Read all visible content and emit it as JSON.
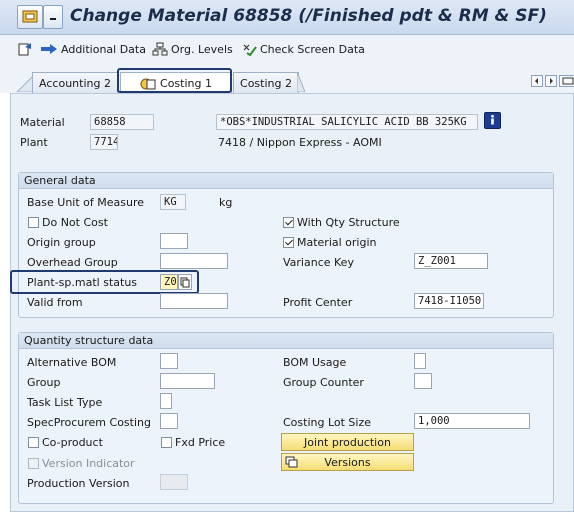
{
  "title_bar": {
    "title": "Change Material 68858 (/Finished pdt & RM & SF)"
  },
  "toolbar": {
    "additional_data": "Additional Data",
    "org_levels": "Org. Levels",
    "check_screen_data": "Check Screen Data"
  },
  "tabs": [
    {
      "label": "Accounting 2",
      "active": false
    },
    {
      "label": "Costing 1",
      "active": true
    },
    {
      "label": "Costing 2",
      "active": false
    }
  ],
  "header": {
    "material_label": "Material",
    "material_value": "68858",
    "material_desc": "*OBS*INDUSTRIAL SALICYLIC ACID BB 325KG",
    "plant_label": "Plant",
    "plant_value": "7714",
    "plant_desc": "7418 / Nippon Express - AOMI"
  },
  "general_data": {
    "title": "General data",
    "base_uom_label": "Base Unit of Measure",
    "base_uom_value": "KG",
    "base_uom_text": "kg",
    "do_not_cost_label": "Do Not Cost",
    "do_not_cost_checked": false,
    "with_qty_structure_label": "With Qty Structure",
    "with_qty_structure_checked": true,
    "origin_group_label": "Origin group",
    "origin_group_value": "",
    "material_origin_label": "Material origin",
    "material_origin_checked": true,
    "overhead_group_label": "Overhead Group",
    "overhead_group_value": "",
    "variance_key_label": "Variance Key",
    "variance_key_value": "Z_Z001",
    "plant_status_label": "Plant-sp.matl status",
    "plant_status_value": "Z0",
    "valid_from_label": "Valid from",
    "valid_from_value": "",
    "profit_center_label": "Profit Center",
    "profit_center_value": "7418-I1050"
  },
  "quantity_structure": {
    "title": "Quantity structure data",
    "alt_bom_label": "Alternative BOM",
    "bom_usage_label": "BOM Usage",
    "group_label": "Group",
    "group_counter_label": "Group Counter",
    "task_list_type_label": "Task List Type",
    "spec_procurem_label": "SpecProcurem Costing",
    "costing_lot_size_label": "Costing Lot Size",
    "costing_lot_size_value": "1,000",
    "co_product_label": "Co-product",
    "fxd_price_label": "Fxd Price",
    "joint_production_label": "Joint production",
    "version_indicator_label": "Version Indicator",
    "versions_label": "Versions",
    "production_version_label": "Production Version"
  },
  "colors": {
    "accent": "#1f3a6e",
    "yellow_button": "#f5dd74",
    "panel": "#e9f0f8"
  }
}
